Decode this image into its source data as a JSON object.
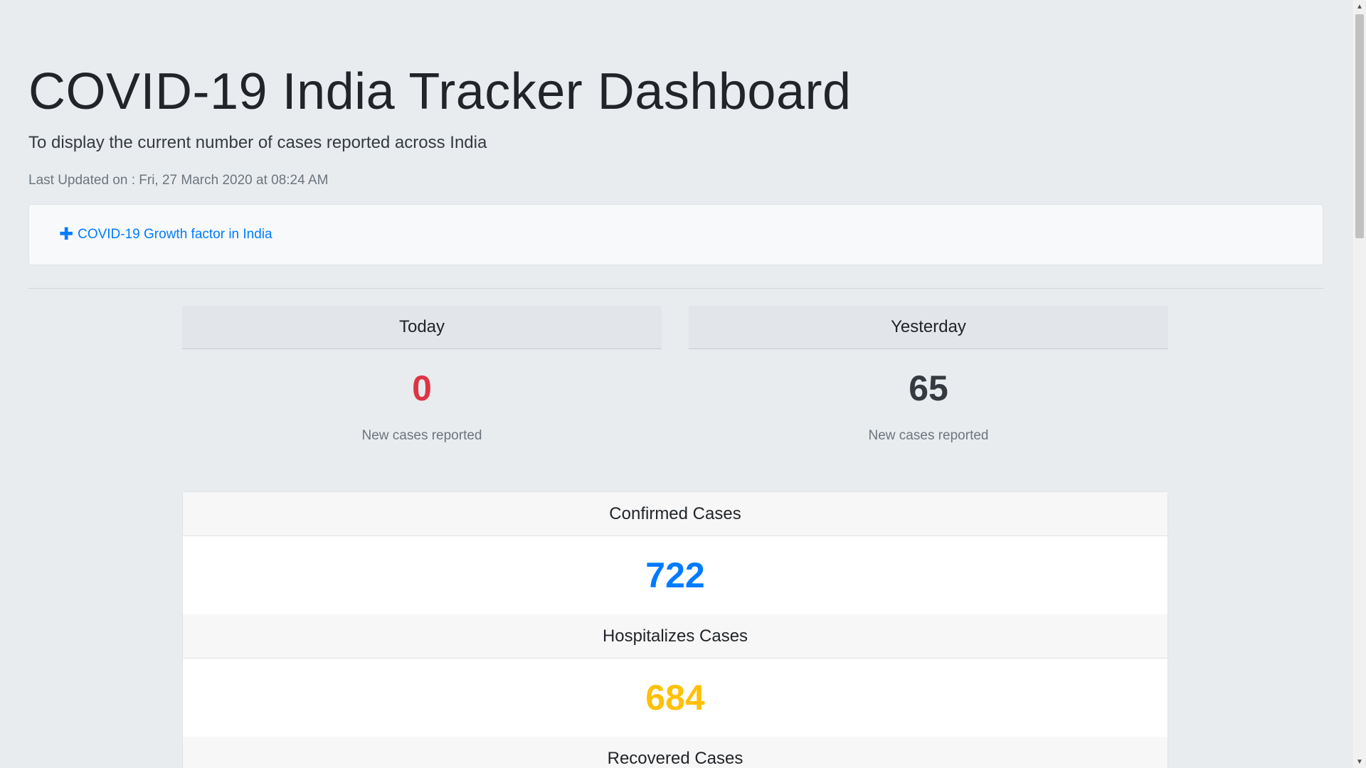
{
  "header": {
    "title": "COVID-19 India Tracker Dashboard",
    "subtitle": "To display the current number of cases reported across India",
    "last_updated": "Last Updated on : Fri, 27 March 2020 at 08:24 AM"
  },
  "growth": {
    "icon": "plus-icon",
    "link_label": "COVID-19 Growth factor in India"
  },
  "daily": [
    {
      "title": "Today",
      "value": "0",
      "label": "New cases reported",
      "color": "#dc3545"
    },
    {
      "title": "Yesterday",
      "value": "65",
      "label": "New cases reported",
      "color": "#343a40"
    }
  ],
  "stats": [
    {
      "title": "Confirmed Cases",
      "value": "722",
      "color": "#007bff"
    },
    {
      "title": "Hospitalizes Cases",
      "value": "684",
      "color": "#ffc107"
    },
    {
      "title": "Recovered Cases"
    }
  ],
  "colors": {
    "background": "#e9ecef",
    "link": "#007bff"
  }
}
